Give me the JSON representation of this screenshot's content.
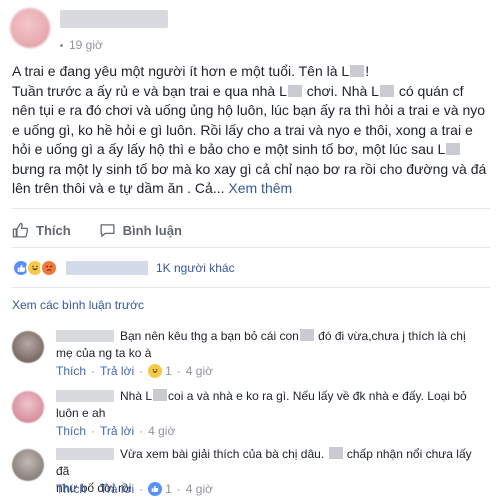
{
  "post": {
    "time": "19 giờ",
    "text_lines": [
      [
        "A trai e đang yêu một người ít hơn e một tuổi. Tên là L",
        "!"
      ],
      [
        "Tuần trước a ấy rủ e và bạn trai e qua nhà L",
        "chơi. Nhà L",
        "có quán cf"
      ],
      [
        "nên tụi e ra đó chơi và uống ủng hộ luôn, lúc bạn ấy ra thì hỏi a trai e và nyo"
      ],
      [
        "e uống gì, ko hề hỏi e gì luôn. Rồi lấy cho a trai và nyo e thôi, xong a trai e"
      ],
      [
        "hỏi e uống gì a ấy lấy hộ thì e bảo cho e một sinh tố bơ, một lúc sau L"
      ],
      [
        "bưng ra một ly sinh tố bơ mà ko xay gì cả chỉ nạo bơ ra rồi cho đường và đá"
      ],
      [
        "lên trên thôi và e tự dầm ăn . Cả..."
      ]
    ],
    "see_more": "Xem thêm"
  },
  "actions": {
    "like_label": "Thích",
    "comment_label": "Bình luận"
  },
  "reactions": {
    "count_text": "1K người khác"
  },
  "view_previous": "Xem các bình luận trước",
  "comments": [
    {
      "text_parts": [
        "Bạn nên kêu thg a bạn bỏ cái con",
        " đó đi vừa,chưa j thích là chị",
        "mẹ của ng ta ko à"
      ],
      "like": "Thích",
      "reply": "Trả lời",
      "count": "1",
      "time": "4 giờ",
      "avatar_color": "#7a6a66"
    },
    {
      "text_parts": [
        "Nhà L",
        "coi a và nhà e ko ra gì. Nếu lấy về đk nhà e đấy. Loại bỏ",
        "luôn e ah"
      ],
      "like": "Thích",
      "reply": "Trả lời",
      "time": "4 giờ",
      "avatar_color": "#d68f9f"
    },
    {
      "text_parts": [
        "Vừa xem bài giải thích của bà chị dâu.",
        "chấp nhận nổi chưa lấy đã",
        "như bố đời rồi"
      ],
      "like": "Thích",
      "reply": "Trả lời",
      "count": "1",
      "time": "4 giờ",
      "avatar_color": "#8a817c"
    }
  ]
}
